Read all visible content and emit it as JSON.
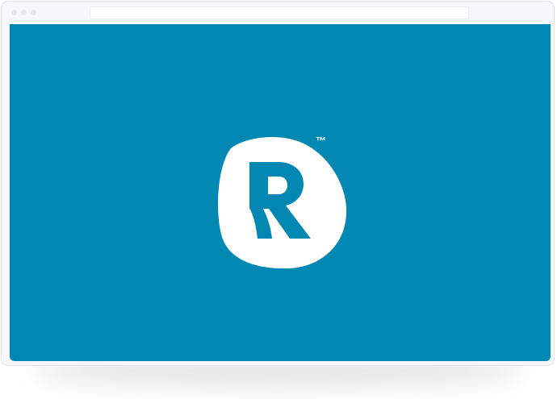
{
  "window": {
    "address_value": ""
  },
  "brand": {
    "trademark": "™"
  },
  "colors": {
    "background": "#0088b2",
    "logo_fill": "#ffffff",
    "window_frame": "#f6f7f9",
    "window_controls": "#e6e8eb"
  },
  "icons": {
    "logo": "r-monogram-logo-icon"
  }
}
